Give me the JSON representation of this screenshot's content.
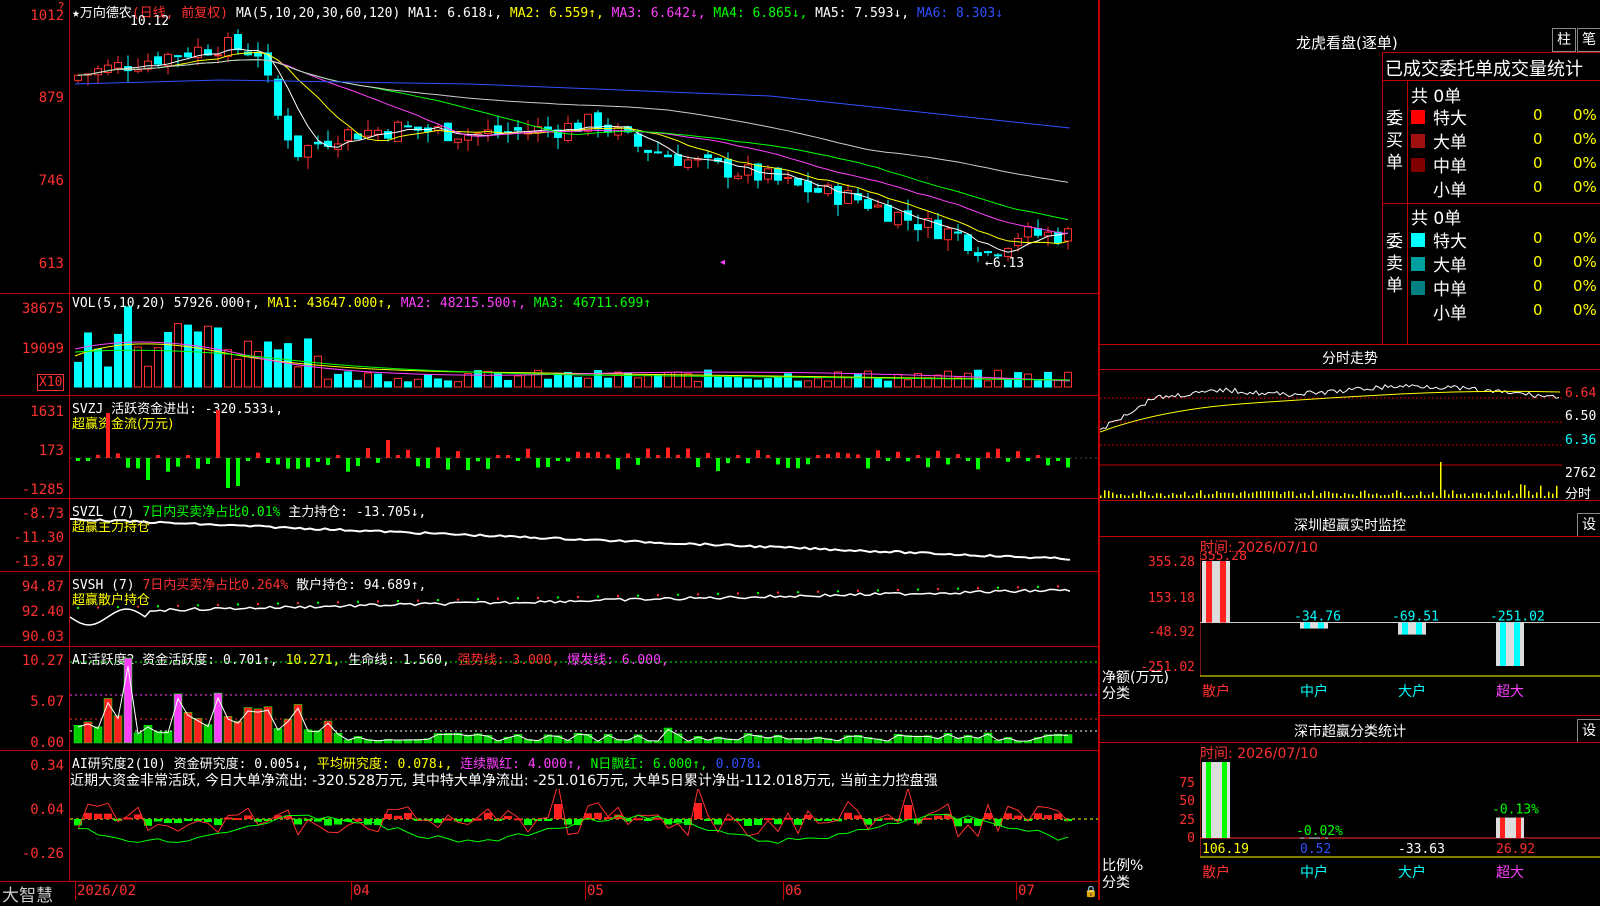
{
  "top_legend": {
    "name": "★万向德农",
    "period": "(日线, 前复权)",
    "ma_label": "MA(5,10,20,30,60,120)",
    "ma1": "MA1: 6.618↓,",
    "ma2": "MA2: 6.559↑,",
    "ma3": "MA3: 6.642↓,",
    "ma4": "MA4: 6.865↓,",
    "ma5": "MA5: 7.593↓,",
    "ma6": "MA6: 8.303↓"
  },
  "price_axis": [
    "1012",
    "879",
    "746",
    "613"
  ],
  "price_marks": {
    "high": "10.12",
    "low": "←6.13"
  },
  "vol": {
    "legend": "VOL(5,10,20)",
    "value": "57926.000↑,",
    "ma1": "MA1: 43647.000↑,",
    "ma2": "MA2: 48215.500↑,",
    "ma3": "MA3: 46711.699↑",
    "axis": [
      "38675",
      "19099"
    ],
    "unit": "X10"
  },
  "svzj": {
    "legend": "SVZJ  活跃资金进出: -320.533↓,",
    "sub": "超赢资金流(万元)",
    "axis": [
      "1631",
      "173",
      "-1285"
    ]
  },
  "svzl": {
    "legend_a": "SVZL (7)",
    "legend_b": "7日内买卖净占比0.01%",
    "legend_c": "主力持仓: -13.705↓,",
    "sub": "超赢主力持仓",
    "axis": [
      "-8.73",
      "-11.30",
      "-13.87"
    ]
  },
  "svsh": {
    "legend_a": "SVSH (7)",
    "legend_b": "7日内买卖净占比0.264%",
    "legend_c": "散户持仓: 94.689↑,",
    "sub": "超赢散户持仓",
    "axis": [
      "94.87",
      "92.40",
      "90.03"
    ]
  },
  "ai1": {
    "legend_a": "AI活跃度2 资金活跃度: 0.701↑,",
    "legend_b": "10.271,",
    "legend_c": "生命线: 1.560,",
    "legend_d": "强势线: 3.000,",
    "legend_e": "爆发线: 6.000,",
    "axis": [
      "10.27",
      "5.07",
      "0.00"
    ]
  },
  "ai2": {
    "legend_a": "AI研究度2(10) 资金研究度: 0.005↓,",
    "legend_b": "平均研究度: 0.078↓,",
    "legend_c": "连续飘红: 4.000↑,",
    "legend_d": "N日飘红: 6.000↑,",
    "legend_e": "0.078↓",
    "message": "近期大资金非常活跃, 今日大单净流出: -320.528万元, 其中特大单净流出: -251.016万元, 大单5日累计净出-112.018万元, 当前主力控盘强",
    "axis": [
      "0.34",
      "0.04",
      "-0.26"
    ]
  },
  "bottom": {
    "brand": "大智慧",
    "dates": [
      "2026/02",
      "04",
      "05",
      "06",
      "07"
    ]
  },
  "dragon": {
    "title": "龙虎看盘(逐单)",
    "btn_bar": "柱",
    "btn_pen": "笔",
    "header": "已成交委托单成交量统计",
    "buy_label": "委买单",
    "sell_label": "委卖单",
    "buy_total": "共 0单",
    "sell_total": "共 0单",
    "buy_rows": [
      {
        "name": "特大",
        "count": "0",
        "pct": "0%"
      },
      {
        "name": "大单",
        "count": "0",
        "pct": "0%"
      },
      {
        "name": "中单",
        "count": "0",
        "pct": "0%"
      },
      {
        "name": "小单",
        "count": "0",
        "pct": "0%"
      }
    ],
    "sell_rows": [
      {
        "name": "特大",
        "count": "0",
        "pct": "0%"
      },
      {
        "name": "大单",
        "count": "0",
        "pct": "0%"
      },
      {
        "name": "中单",
        "count": "0",
        "pct": "0%"
      },
      {
        "name": "小单",
        "count": "0",
        "pct": "0%"
      }
    ],
    "colors": {
      "buy": [
        "#ff0000",
        "#a01010",
        "#800000",
        "#000000"
      ],
      "sell": [
        "#00ffff",
        "#00a0a0",
        "#008080",
        "#000000"
      ]
    }
  },
  "intraday": {
    "title": "分时走势",
    "axis": [
      "6.64",
      "6.50",
      "6.36"
    ],
    "vol_label": "2762",
    "vol_unit": "分时"
  },
  "monitor": {
    "title": "深圳超赢实时监控",
    "set_btn": "设",
    "time": "时间: 2026/07/10",
    "axis": [
      "355.28",
      "153.18",
      "-48.92",
      "-251.02"
    ],
    "ylabel": "净额(万元)",
    "xlabel": "分类",
    "chart_data": {
      "type": "bar",
      "categories": [
        "散户",
        "中户",
        "大户",
        "超大"
      ],
      "values": [
        355.28,
        -34.76,
        -69.51,
        -251.02
      ],
      "value_labels": [
        "355.28",
        "-34.76",
        "-69.51",
        "-251.02"
      ],
      "ylim": [
        -251.02,
        355.28
      ]
    }
  },
  "classify": {
    "title": "深市超赢分类统计",
    "set_btn": "设",
    "time": "时间: 2026/07/10",
    "axis": [
      "75",
      "50",
      "25",
      "0"
    ],
    "ylabel": "比例%",
    "xlabel": "分类",
    "chart_data": {
      "type": "bar",
      "categories": [
        "散户",
        "中户",
        "大户",
        "超大"
      ],
      "values": [
        106.19,
        0.52,
        -33.63,
        26.92
      ],
      "bottom_labels": [
        "106.19",
        "0.52",
        "-33.63",
        "26.92"
      ],
      "top_labels": [
        "",
        "-0.02%",
        "",
        "-0.13%"
      ],
      "ylim": [
        0,
        100
      ]
    }
  }
}
